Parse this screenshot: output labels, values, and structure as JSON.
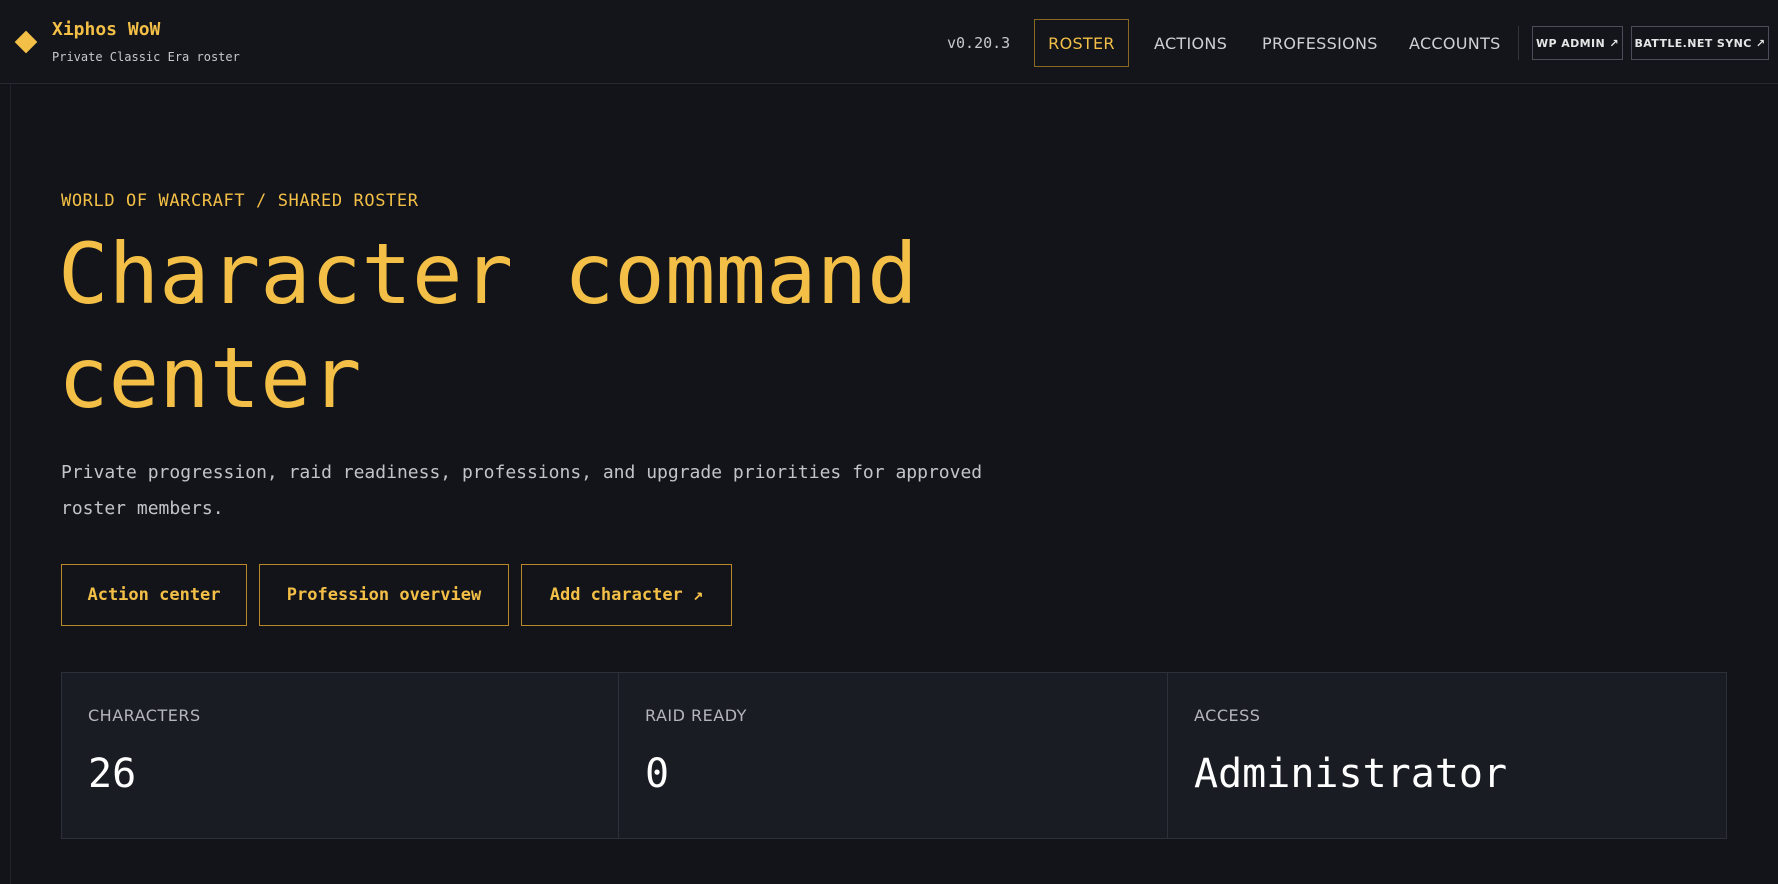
{
  "header": {
    "brand_name": "Xiphos WoW",
    "brand_subtitle": "Private Classic Era roster",
    "version": "v0.20.3",
    "nav": [
      {
        "label": "ROSTER",
        "active": true
      },
      {
        "label": "ACTIONS",
        "active": false
      },
      {
        "label": "PROFESSIONS",
        "active": false
      },
      {
        "label": "ACCOUNTS",
        "active": false
      }
    ],
    "external": [
      {
        "label": "WP ADMIN ↗"
      },
      {
        "label": "BATTLE.NET SYNC ↗"
      }
    ]
  },
  "hero": {
    "eyebrow": "WORLD OF WARCRAFT / SHARED ROSTER",
    "title": "Character command center",
    "description": "Private progression, raid readiness, professions, and upgrade priorities for approved roster members.",
    "buttons": [
      {
        "label": "Action center"
      },
      {
        "label": "Profession overview"
      },
      {
        "label": "Add character ↗"
      }
    ]
  },
  "stats": [
    {
      "label": "CHARACTERS",
      "value": "26"
    },
    {
      "label": "RAID READY",
      "value": "0"
    },
    {
      "label": "ACCESS",
      "value": "Administrator"
    }
  ],
  "colors": {
    "accent": "#f3bf46",
    "background": "#12141a",
    "panel": "#1a1c23",
    "text": "#e6e6e6"
  },
  "icons": {
    "brand": "diamond-icon",
    "external": "arrow-up-right-icon"
  }
}
